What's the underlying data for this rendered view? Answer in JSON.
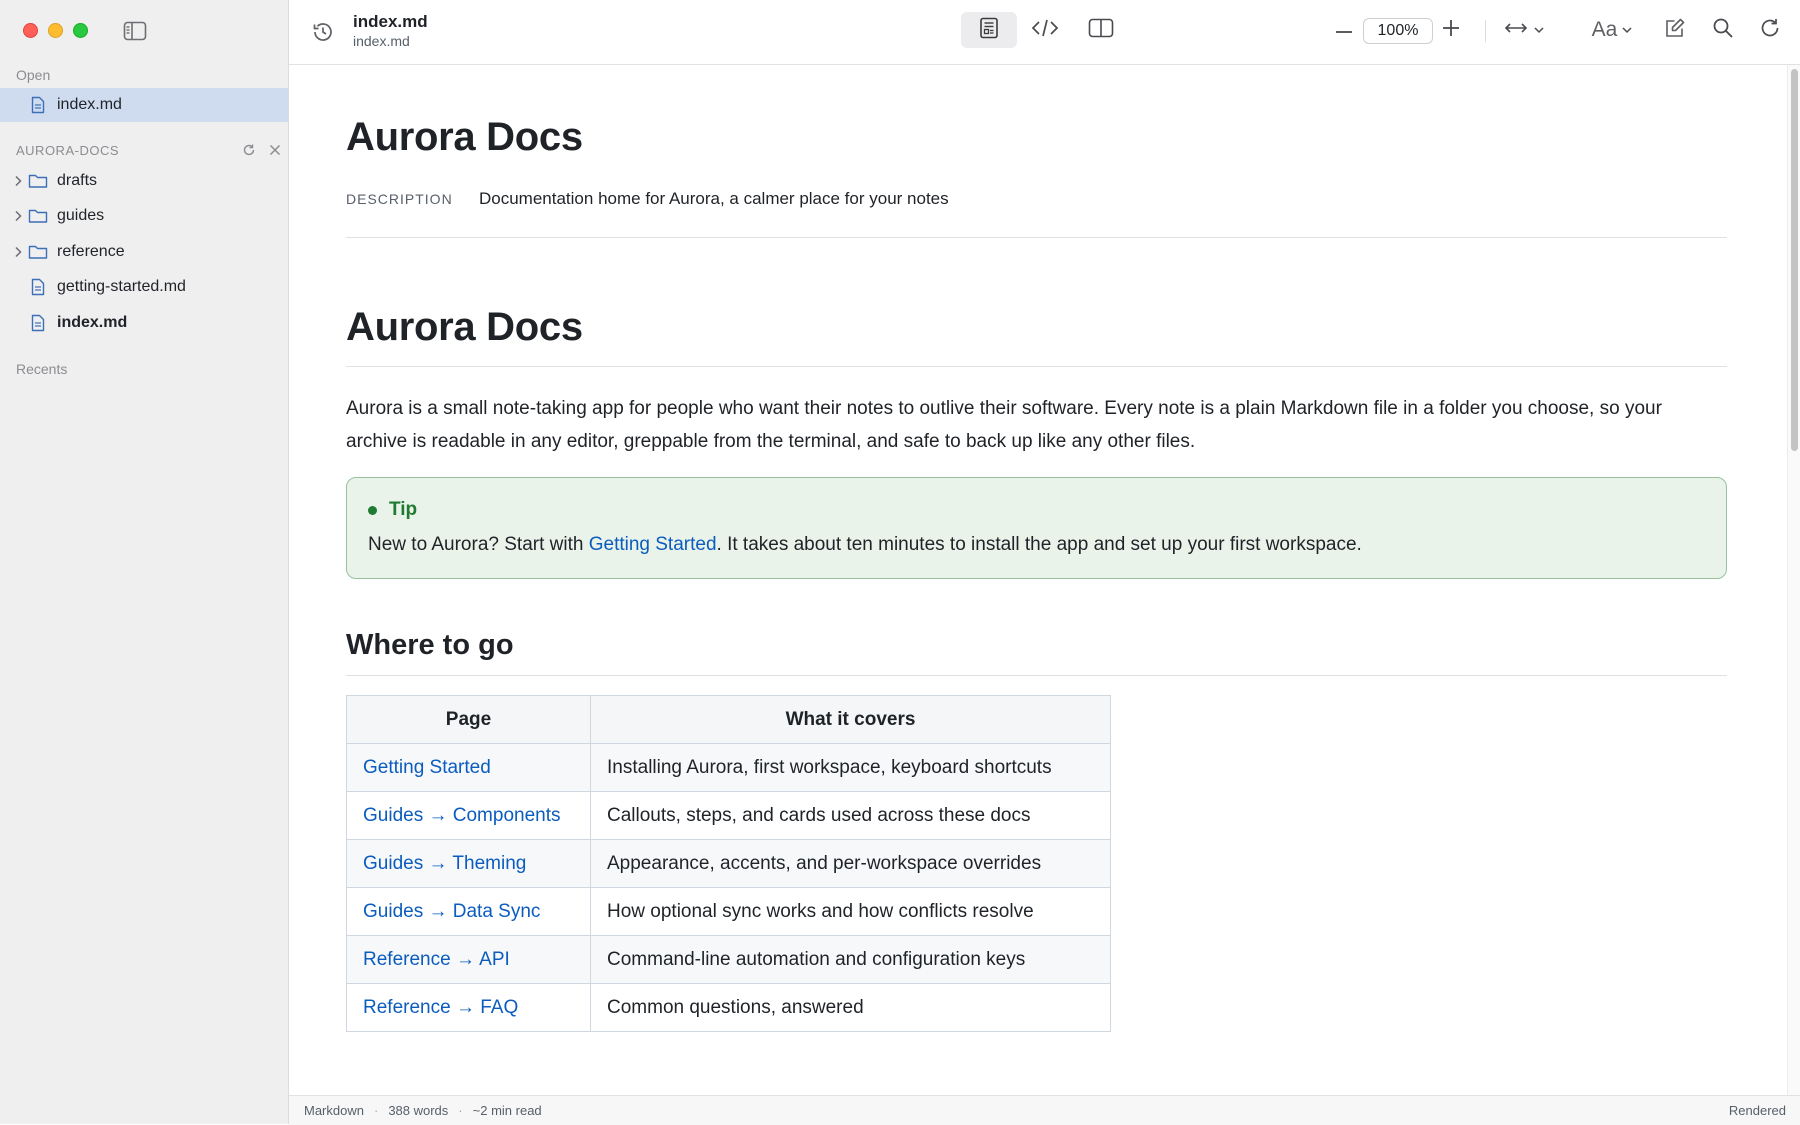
{
  "sidebar": {
    "open_label": "Open",
    "open_items": [
      {
        "label": "index.md",
        "icon": "file-icon"
      }
    ],
    "project_label": "AURORA-DOCS",
    "tree": [
      {
        "label": "drafts",
        "type": "folder"
      },
      {
        "label": "guides",
        "type": "folder"
      },
      {
        "label": "reference",
        "type": "folder"
      },
      {
        "label": "getting-started.md",
        "type": "file"
      },
      {
        "label": "index.md",
        "type": "file"
      }
    ],
    "recents_label": "Recents"
  },
  "toolbar": {
    "title": "index.md",
    "subtitle": "index.md",
    "zoom": "100%",
    "font_label": "Aa"
  },
  "document": {
    "frontmatter_title": "Aurora Docs",
    "frontmatter_key": "DESCRIPTION",
    "frontmatter_value": "Documentation home for Aurora, a calmer place for your notes",
    "h1": "Aurora Docs",
    "intro": "Aurora is a small note-taking app for people who want their notes to outlive their software. Every note is a plain Markdown file in a folder you choose, so your archive is readable in any editor, greppable from the terminal, and safe to back up like any other files.",
    "tip": {
      "title": "Tip",
      "before": "New to Aurora? Start with ",
      "link": "Getting Started",
      "after": ". It takes about ten minutes to install the app and set up your first workspace."
    },
    "h2": "Where to go",
    "table": {
      "headers": [
        "Page",
        "What it covers"
      ],
      "rows": [
        [
          "Getting Started",
          "Installing Aurora, first workspace, keyboard shortcuts"
        ],
        [
          "Guides → Components",
          "Callouts, steps, and cards used across these docs"
        ],
        [
          "Guides → Theming",
          "Appearance, accents, and per-workspace overrides"
        ],
        [
          "Guides → Data Sync",
          "How optional sync works and how conflicts resolve"
        ],
        [
          "Reference → API",
          "Command-line automation and configuration keys"
        ],
        [
          "Reference → FAQ",
          "Common questions, answered"
        ]
      ]
    }
  },
  "status": {
    "mode": "Markdown",
    "words": "388 words",
    "read_time": "~2 min read",
    "view": "Rendered"
  }
}
